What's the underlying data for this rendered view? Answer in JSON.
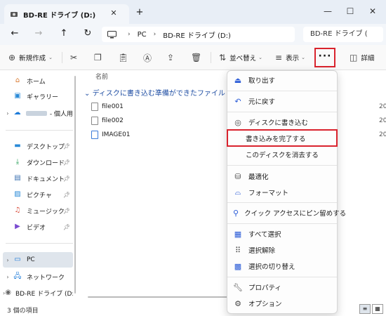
{
  "window": {
    "tab_title": "BD-RE ドライブ (D:)",
    "tab_close": "✕",
    "new_tab": "+",
    "minimize": "—",
    "maximize": "☐",
    "close": "✕"
  },
  "address": {
    "back": "←",
    "forward": "→",
    "up": "↑",
    "refresh": "↻",
    "crumb_pc": "PC",
    "crumb_drive": "BD-RE ドライブ (D:)",
    "chevron": "›",
    "search_placeholder": "BD-RE ドライブ ("
  },
  "toolbar": {
    "new_label": "新規作成",
    "sort_label": "並べ替え",
    "view_label": "表示",
    "more_label": "···",
    "details_label": "詳細"
  },
  "sidebar": {
    "items": [
      {
        "label": "ホーム",
        "icon": "home-icon"
      },
      {
        "label": "ギャラリー",
        "icon": "gallery-icon"
      },
      {
        "label": "- 個人用",
        "icon": "onedrive-icon"
      },
      {
        "label": "デスクトップ",
        "icon": "desktop-icon"
      },
      {
        "label": "ダウンロード",
        "icon": "download-icon"
      },
      {
        "label": "ドキュメント",
        "icon": "documents-icon"
      },
      {
        "label": "ピクチャ",
        "icon": "pictures-icon"
      },
      {
        "label": "ミュージック",
        "icon": "music-icon"
      },
      {
        "label": "ビデオ",
        "icon": "video-icon"
      },
      {
        "label": "PC",
        "icon": "pc-icon"
      },
      {
        "label": "ネットワーク",
        "icon": "network-icon"
      },
      {
        "label": "BD-RE ドライブ (D:",
        "icon": "disc-drive-icon"
      }
    ]
  },
  "content": {
    "column_name": "名前",
    "group_header": "ディスクに書き込む準備ができたファイル",
    "files": [
      "file001",
      "file002",
      "IMAGE01"
    ],
    "date_fragment": "20"
  },
  "status": {
    "item_count": "3 個の項目"
  },
  "menu": {
    "items": [
      {
        "label": "取り出す",
        "icon": "eject-icon"
      },
      {
        "label": "元に戻す",
        "icon": "undo-icon"
      },
      {
        "label": "ディスクに書き込む",
        "icon": "burn-disc-icon"
      },
      {
        "label": "書き込みを完了する",
        "icon": ""
      },
      {
        "label": "このディスクを消去する",
        "icon": ""
      },
      {
        "label": "最適化",
        "icon": "optimize-icon"
      },
      {
        "label": "フォーマット",
        "icon": "format-icon"
      },
      {
        "label": "クイック アクセスにピン留めする",
        "icon": "pin-icon"
      },
      {
        "label": "すべて選択",
        "icon": "select-all-icon"
      },
      {
        "label": "選択解除",
        "icon": "select-none-icon"
      },
      {
        "label": "選択の切り替え",
        "icon": "invert-selection-icon"
      },
      {
        "label": "プロパティ",
        "icon": "properties-icon"
      },
      {
        "label": "オプション",
        "icon": "options-icon"
      }
    ]
  },
  "colors": {
    "accent": "#2a5bd7",
    "highlight_border": "#d9232d",
    "group_text": "#1f4ea3"
  }
}
